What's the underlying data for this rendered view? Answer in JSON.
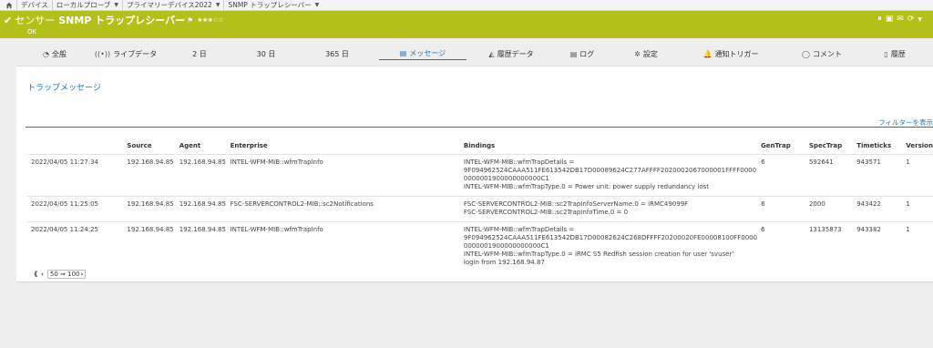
{
  "breadcrumb": {
    "home_icon": "home-icon",
    "items": [
      {
        "label": "デバイス"
      },
      {
        "label": "ローカルプローブ"
      },
      {
        "label": "プライマリーデバイス2022"
      },
      {
        "label": "SNMP トラップレシーバー"
      }
    ]
  },
  "header": {
    "kind": "センサー",
    "name": "SNMP トラップレシーバー",
    "flag": "⚑",
    "stars": "★★★☆☆",
    "status": "OK",
    "accent": "#b3c019"
  },
  "tabs": [
    {
      "icon": "◔",
      "label": "全般"
    },
    {
      "icon": "((•))",
      "label": "ライブデータ"
    },
    {
      "icon": "",
      "label": "2 日"
    },
    {
      "icon": "",
      "label": "30 日"
    },
    {
      "icon": "",
      "label": "365 日"
    },
    {
      "icon": "▤",
      "label": "メッセージ"
    },
    {
      "icon": "◭",
      "label": "履歴データ"
    },
    {
      "icon": "▤",
      "label": "ログ"
    },
    {
      "icon": "✲",
      "label": "設定"
    },
    {
      "icon": "🔔",
      "label": "通知トリガー"
    },
    {
      "icon": "◯",
      "label": "コメント"
    },
    {
      "icon": "▯",
      "label": "履歴"
    }
  ],
  "panel": {
    "title": "トラップメッセージ",
    "filter_link": "フィルターを表示"
  },
  "table": {
    "headers": [
      "",
      "Source",
      "Agent",
      "Enterprise",
      "Bindings",
      "GenTrap",
      "SpecTrap",
      "Timeticks",
      "Version"
    ],
    "rows": [
      {
        "time": "2022/04/05 11:27:34",
        "source": "192.168.94.85",
        "agent": "192.168.94.85",
        "enterprise": "INTEL-WFM-MIB::wfmTrapInfo",
        "bindings": [
          "INTEL-WFM-MIB::wfmTrapDetails =",
          "9F094962524CAAA511FE613542DB17D00089624C277AFFFF2020002067000001FFFF0000",
          "0000001900000000000C1",
          "INTEL-WFM-MIB::wfmTrapType.0 = Power unit: power supply redundancy lost"
        ],
        "gentrap": "6",
        "spectrap": "592641",
        "timeticks": "943571",
        "version": "1"
      },
      {
        "time": "2022/04/05 11:25:05",
        "source": "192.168.94.85",
        "agent": "192.168.94.85",
        "enterprise": "FSC-SERVERCONTROL2-MIB::sc2Notifications",
        "bindings": [
          "FSC-SERVERCONTROL2-MIB::sc2TrapInfoServerName.0 = iRMC49099F",
          "FSC-SERVERCONTROL2-MIB::sc2TrapInfoTime.0 = 0"
        ],
        "gentrap": "6",
        "spectrap": "2000",
        "timeticks": "943422",
        "version": "1"
      },
      {
        "time": "2022/04/05 11:24:25",
        "source": "192.168.94.85",
        "agent": "192.168.94.85",
        "enterprise": "INTEL-WFM-MIB::wfmTrapInfo",
        "bindings": [
          "INTEL-WFM-MIB::wfmTrapDetails =",
          "9F094962524CAAA511FE613542DB17D00082624C268DFFFF20200020FE00008100FF0000",
          "0000001900000000000C1",
          "INTEL-WFM-MIB::wfmTrapType.0 = iRMC S5 Redfish session creation for user 'svuser'",
          "login from 192.168.94.87"
        ],
        "gentrap": "6",
        "spectrap": "13135873",
        "timeticks": "943382",
        "version": "1"
      }
    ]
  },
  "pager": {
    "first": "《",
    "prev": "‹",
    "page_size": "50 ⇒ 100",
    "next": "›"
  }
}
